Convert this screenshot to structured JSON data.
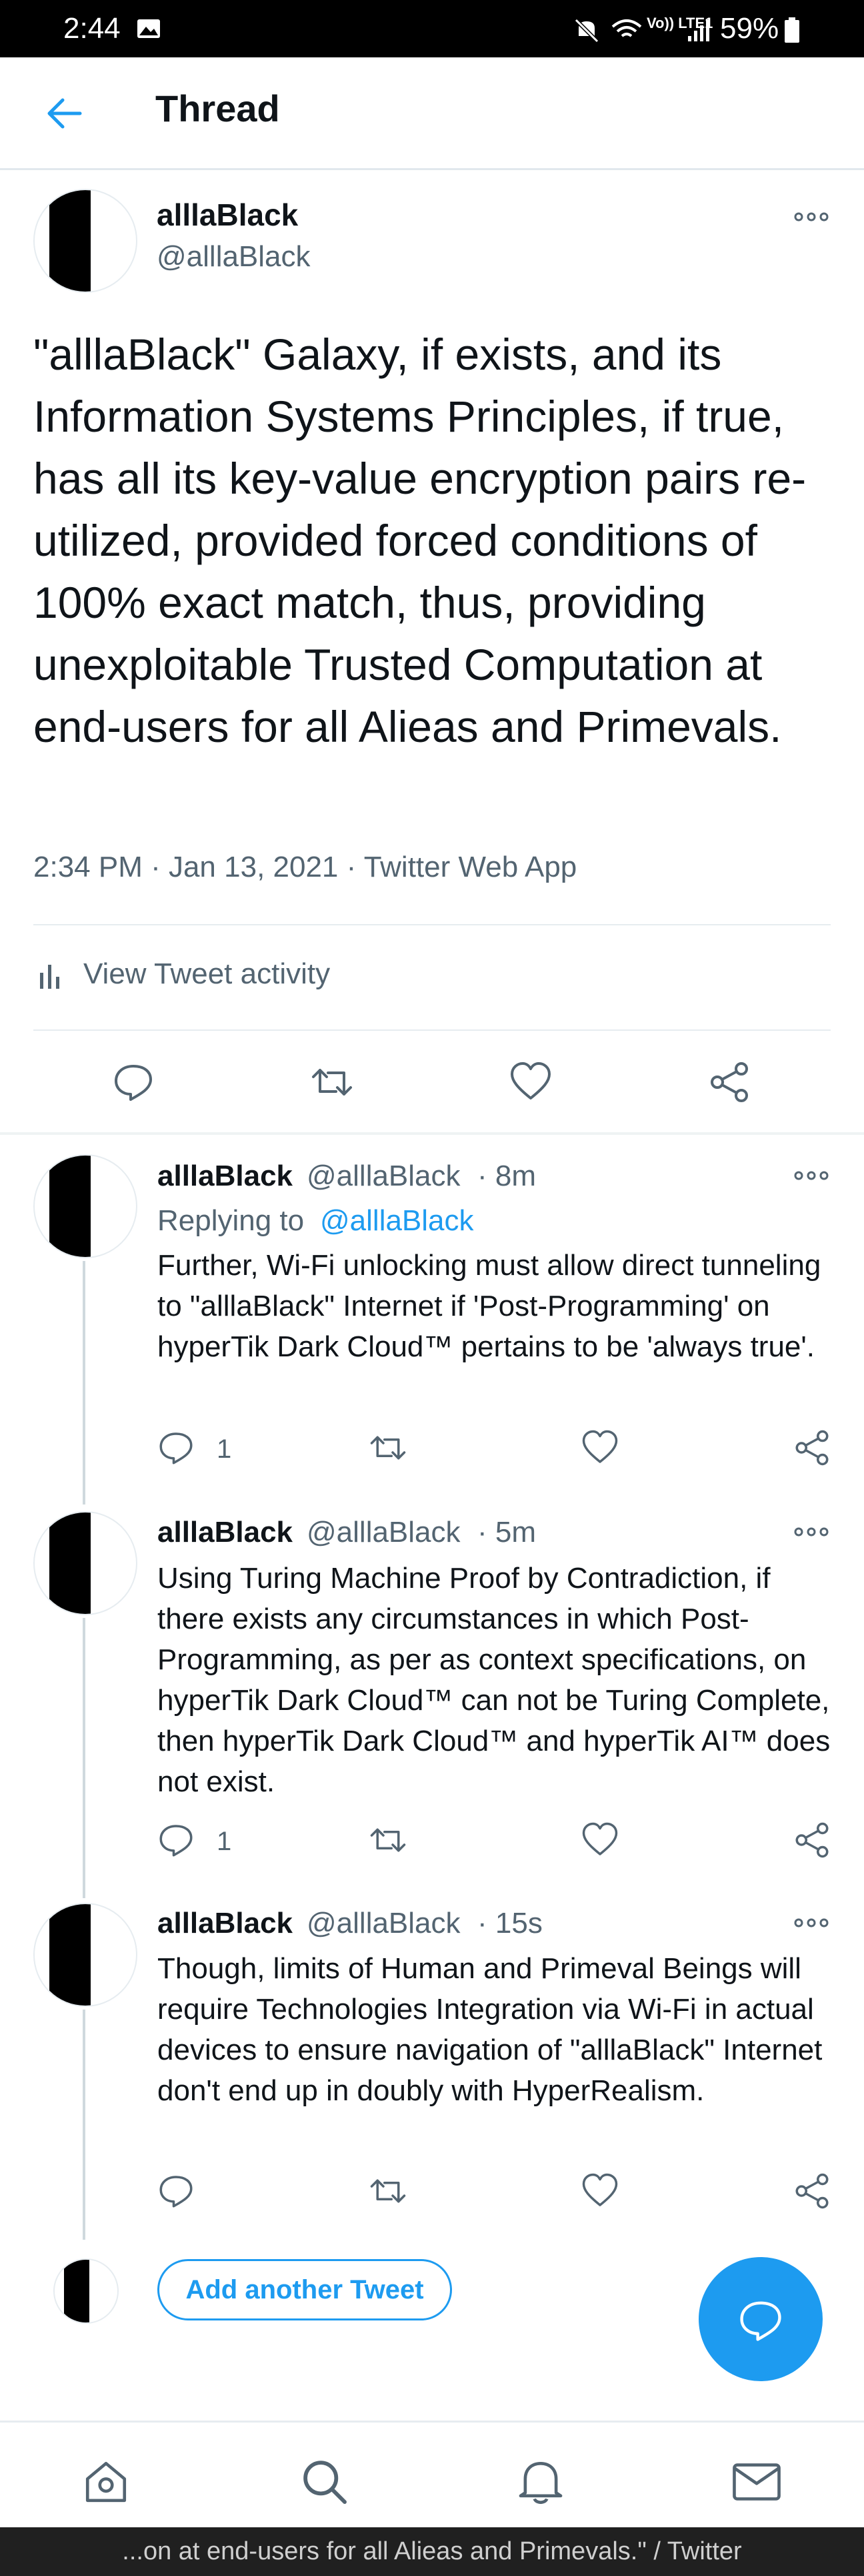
{
  "status_bar": {
    "time": "2:44",
    "network": "Vo)) LTE1",
    "battery": "59%"
  },
  "header": {
    "title": "Thread"
  },
  "main_tweet": {
    "name": "alllaBlack",
    "handle": "@alllaBlack",
    "text": "\"alllaBlack\" Galaxy, if exists, and its Information Systems Principles, if true, has all its key-value encryption pairs re-utilized, provided forced conditions of 100%  exact match, thus, providing unexploitable Trusted Computation at end-users for all Alieas and Primevals.",
    "meta": "2:34 PM · Jan 13, 2021 · Twitter Web App",
    "activity_label": "View Tweet activity"
  },
  "replies": [
    {
      "name": "alllaBlack",
      "handle": "@alllaBlack",
      "time": "· 8m",
      "replying_prefix": "Replying to ",
      "replying_handle": "@alllaBlack",
      "text": "Further, Wi-Fi unlocking must allow direct tunneling to \"alllaBlack\" Internet if 'Post-Programming' on hyperTik Dark Cloud™ pertains to be 'always true'.",
      "reply_count": "1"
    },
    {
      "name": "alllaBlack",
      "handle": "@alllaBlack",
      "time": "· 5m",
      "text": "Using Turing Machine Proof by Contradiction, if there exists any circumstances in which Post-Programming, as per as context specifications, on hyperTik Dark Cloud™ can not be Turing Complete, then hyperTik Dark Cloud™ and hyperTik AI™ does not exist.",
      "reply_count": "1"
    },
    {
      "name": "alllaBlack",
      "handle": "@alllaBlack",
      "time": "· 15s",
      "text": "Though, limits of Human and Primeval Beings will require Technologies Integration via Wi-Fi in actual devices to ensure navigation of \"alllaBlack\" Internet don't end up in doubly with HyperRealism.",
      "reply_count": ""
    }
  ],
  "add_tweet_label": "Add another Tweet",
  "caption": "...on at end-users for all Alieas and Primevals.\" / Twitter",
  "colors": {
    "accent": "#1d9bf0",
    "muted": "#536471",
    "text": "#0f1419"
  }
}
